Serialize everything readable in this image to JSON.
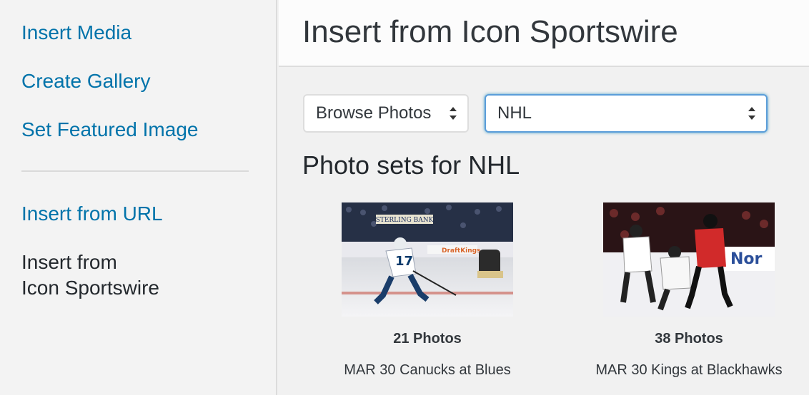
{
  "sidebar": {
    "links": [
      {
        "label": "Insert Media"
      },
      {
        "label": "Create Gallery"
      },
      {
        "label": "Set Featured Image"
      },
      {
        "label": "Insert from URL"
      }
    ],
    "current": {
      "line1": "Insert from",
      "line2": "Icon Sportswire"
    }
  },
  "header": {
    "title": "Insert from Icon Sportswire"
  },
  "filters": {
    "browse_value": "Browse Photos",
    "league_value": "NHL"
  },
  "section": {
    "title": "Photo sets for NHL"
  },
  "photosets": [
    {
      "count": "21 Photos",
      "caption": "MAR 30 Canucks at Blues",
      "banner_text": "STERLING BANK",
      "ad_text": "DraftKings",
      "jersey": "17"
    },
    {
      "count": "38 Photos",
      "caption": "MAR 30 Kings at Blackhawks",
      "ad_text": "Nor"
    }
  ],
  "colors": {
    "link": "#0073aa",
    "text": "#23282d",
    "focus": "#5b9dd9"
  }
}
